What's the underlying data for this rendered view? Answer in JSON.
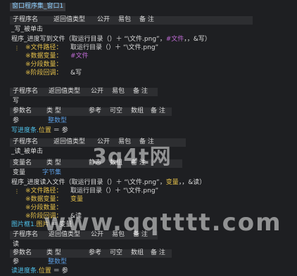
{
  "tab_title": "窗口程序集_窗口1",
  "watermark": {
    "small": "3q4t网",
    "large": "www.qqtttt.com"
  },
  "header_cols": {
    "sub": "子程序名",
    "ret": "返回值类型",
    "pub": "公开",
    "easy": "易包",
    "note": "备 注"
  },
  "param_cols": {
    "name": "参数名",
    "type": "类 型",
    "ref": "参考",
    "nullable": "可空",
    "array": "数组",
    "note": "备 注"
  },
  "var_cols": {
    "name": "变量名",
    "type": "类 型",
    "static": "静态",
    "array": "数组",
    "note": "备 注"
  },
  "sub1": {
    "name": "_写_被单击",
    "call": "程序_进度写到文件（取运行目录（）＋ “\\文件.png”，#文件，，&写）",
    "call_a": "程序_进度写到文件（取运行目录（）＋ “\\文件.png”，",
    "call_b": "#文件",
    "call_c": "，，&写）",
    "comments": [
      {
        "label": "※文件路径：",
        "value": "取运行目录（）＋ “\\文件.png”",
        "color": "white"
      },
      {
        "label": "※数据变量：",
        "value": "#文件",
        "color": "purple"
      },
      {
        "label": "※分段数量：",
        "value": "",
        "color": "white"
      },
      {
        "label": "※阶段回调：",
        "value": "&写",
        "color": "white"
      }
    ]
  },
  "sub2": {
    "name": "写",
    "param_name": "参",
    "param_type": "整数型",
    "stmt": "写进度条.位置 ＝ 参",
    "stmt_a": "写进度条.",
    "stmt_b": "位置",
    "stmt_c": " ＝ 参"
  },
  "sub3": {
    "name": "_读_被单击",
    "var_name": "变量",
    "var_type": "字节集",
    "call_a": "程序_进度读入文件（取运行目录（）＋ “\\文件.png”，",
    "call_b": "变量",
    "call_c": "，，&读）",
    "comments": [
      {
        "label": "※文件路径：",
        "value": "取运行目录（）＋ “\\文件.png”",
        "color": "white"
      },
      {
        "label": "※数据变量：",
        "value": "变量",
        "color": "yellow"
      },
      {
        "label": "※分段数量：",
        "value": "",
        "color": "white"
      },
      {
        "label": "※阶段回调：",
        "value": "&读",
        "color": "white"
      }
    ],
    "stmt_a": "图片框1.",
    "stmt_b": "图片",
    "stmt_c": " ＝ 变量"
  },
  "sub4": {
    "name": "读",
    "param_name": "参",
    "param_type": "整数型",
    "stmt_a": "读进度条.",
    "stmt_b": "位置",
    "stmt_c": " ＝ 参"
  }
}
